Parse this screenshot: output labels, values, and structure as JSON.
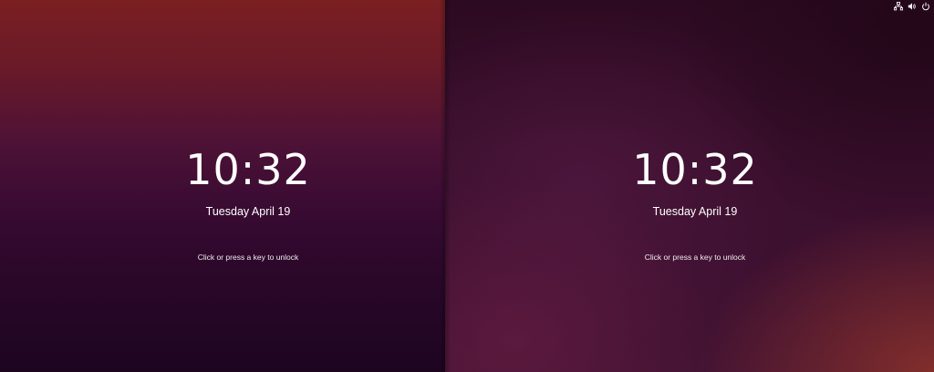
{
  "screens": [
    {
      "clock": "10:32",
      "date": "Tuesday April 19",
      "hint": "Click or press a key to unlock"
    },
    {
      "clock": "10:32",
      "date": "Tuesday April 19",
      "hint": "Click or press a key to unlock",
      "tray": {
        "icons": [
          "network-icon",
          "volume-icon",
          "power-icon"
        ]
      }
    }
  ],
  "colors": {
    "text": "#ffffff",
    "left_top": "#7a1f22",
    "left_bottom": "#1d0520",
    "right_base": "#3a0f2d",
    "right_glow": "#96372a"
  }
}
